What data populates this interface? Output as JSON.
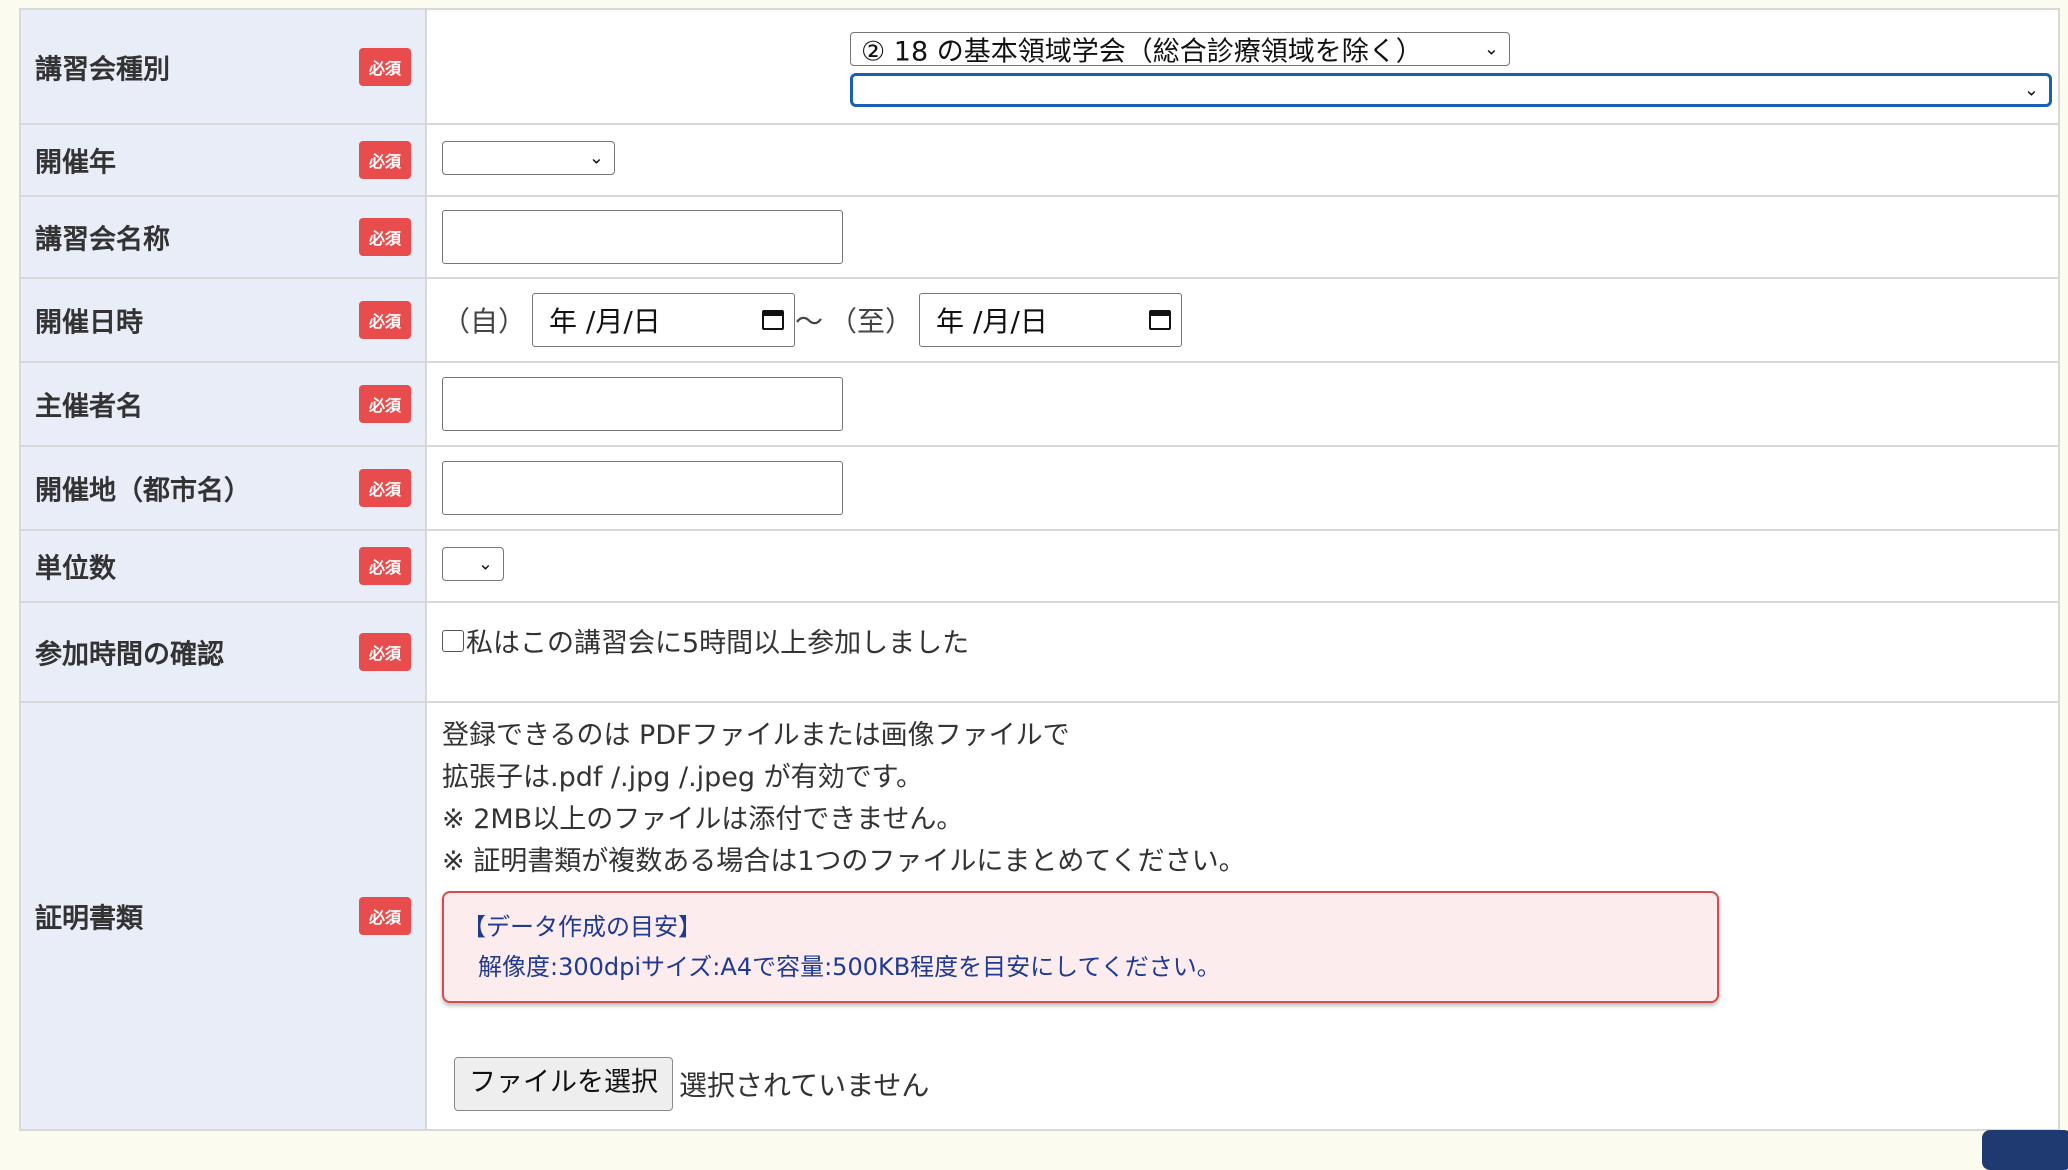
{
  "required_badge": "必須",
  "rows": {
    "seminar_type": {
      "label": "講習会種別",
      "selected": "② 18 の基本領域学会（総合診療領域を除く）",
      "sub_selected": ""
    },
    "year": {
      "label": "開催年",
      "selected": ""
    },
    "seminar_name": {
      "label": "講習会名称",
      "value": ""
    },
    "dates": {
      "label": "開催日時",
      "from_label": "（自）",
      "to_label": "（至）",
      "separator": "〜",
      "from_placeholder": "年 /月/日",
      "to_placeholder": "年 /月/日"
    },
    "organizer": {
      "label": "主催者名",
      "value": ""
    },
    "venue": {
      "label": "開催地（都市名）",
      "value": ""
    },
    "units": {
      "label": "単位数",
      "selected": ""
    },
    "attendance": {
      "label": "参加時間の確認",
      "checkbox_label": "私はこの講習会に5時間以上参加しました",
      "checked": false
    },
    "certificate": {
      "label": "証明書類",
      "lines": [
        "登録できるのは PDFファイルまたは画像ファイルで",
        "拡張子は.pdf /.jpg /.jpeg が有効です。",
        "※ 2MB以上のファイルは添付できません。",
        "※ 証明書類が複数ある場合は1つのファイルにまとめてください。"
      ],
      "note_title": "【データ作成の目安】",
      "note_body": "解像度:300dpiサイズ:A4で容量:500KB程度を目安にしてください。",
      "file_button": "ファイルを選択",
      "file_status": "選択されていません"
    }
  },
  "colors": {
    "label_bg": "#e8edf8",
    "required_badge": "#e84c4c",
    "note_border": "#d94a4a",
    "note_bg": "#fdecee",
    "note_text": "#1f3a93",
    "focus_outline": "#1a5fb4"
  },
  "icons": {
    "select_arrow": "chevron-down-icon",
    "date_picker": "calendar-icon"
  }
}
